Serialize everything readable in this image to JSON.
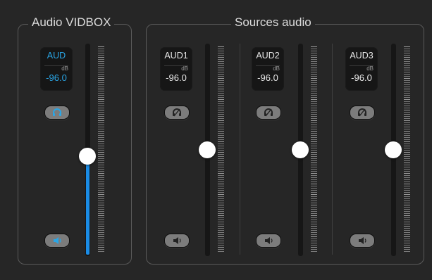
{
  "audio_vidbox": {
    "title": "Audio VIDBOX",
    "channel": {
      "name": "AUD",
      "unit": "dB",
      "value": "-96.0",
      "level": 0.47,
      "fill_level": 0.47,
      "active": true
    }
  },
  "sources_audio": {
    "title": "Sources audio",
    "channels": [
      {
        "name": "AUD1",
        "unit": "dB",
        "value": "-96.0",
        "level": 0.5
      },
      {
        "name": "AUD2",
        "unit": "dB",
        "value": "-96.0",
        "level": 0.5
      },
      {
        "name": "AUD3",
        "unit": "dB",
        "value": "-96.0",
        "level": 0.5
      }
    ]
  },
  "colors": {
    "accent": "#1a8ce6",
    "active_text": "#2aa6e6",
    "background": "#262626"
  },
  "icons": {
    "headphones": "headphones-icon",
    "headphones_off": "headphones-off-icon",
    "speaker": "speaker-icon"
  }
}
